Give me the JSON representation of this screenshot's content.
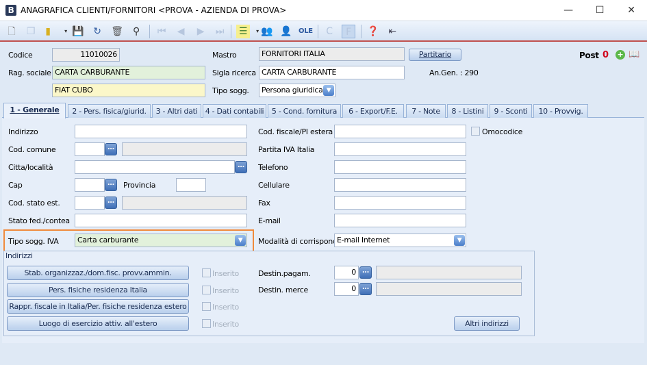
{
  "window": {
    "title": "ANAGRAFICA CLIENTI/FORNITORI <PROVA - AZIENDA DI PROVA>",
    "app_icon": "B",
    "minimize": "—",
    "maximize": "☐",
    "close": "✕"
  },
  "header": {
    "codice_label": "Codice",
    "codice_value": "11010026",
    "mastro_label": "Mastro",
    "mastro_value": "FORNITORI ITALIA",
    "partitario_label": "Partitario",
    "post_label": "Post",
    "post_value": "0",
    "rag_sociale_label": "Rag. sociale",
    "rag_sociale_value": "CARTA CARBURANTE",
    "rag_sociale2_value": "FIAT  CUBO",
    "sigla_label": "Sigla ricerca",
    "sigla_value": "CARTA CARBURANTE",
    "angen": "An.Gen.  : 290",
    "tipo_sogg_label": "Tipo sogg.",
    "tipo_sogg_value": "Persona giuridica"
  },
  "tabs": [
    "1 - Generale",
    "2 - Pers. fisica/giurid.",
    "3 - Altri dati",
    "4 - Dati contabili",
    "5 - Cond. fornitura",
    "6 - Export/F.E.",
    "7 - Note",
    "8 - Listini",
    "9 - Sconti",
    "10 - Provvig."
  ],
  "general": {
    "indirizzo": "Indirizzo",
    "cod_comune": "Cod. comune",
    "citta": "Citta/località",
    "cap": "Cap",
    "provincia": "Provincia",
    "cod_stato": "Cod. stato est.",
    "stato_fed": "Stato fed./contea",
    "tipo_iva_label": "Tipo sogg. IVA",
    "tipo_iva_value": "Carta carburante",
    "cod_fiscale": "Cod. fiscale/PI estera",
    "omocodice": "Omocodice",
    "partita_iva": "Partita IVA Italia",
    "telefono": "Telefono",
    "cellulare": "Cellulare",
    "fax": "Fax",
    "email": "E-mail",
    "modalita_label": "Modalità di corrispond.",
    "modalita_value": "E-mail Internet"
  },
  "indirizzi": {
    "title": "Indirizzi",
    "buttons": [
      "Stab. organizzaz./dom.fisc. provv.ammin.",
      "Pers. fisiche residenza Italia",
      "Rappr. fiscale in Italia/Per. fisiche residenza estero",
      "Luogo di esercizio attiv. all'estero"
    ],
    "inserito": "Inserito",
    "destin_pagam": "Destin.pagam.",
    "destin_pagam_value": "0",
    "destin_merce": "Destin. merce",
    "destin_merce_value": "0",
    "altri": "Altri indirizzi"
  },
  "colors": {
    "highlight": "#f08a3c",
    "post_value": "#d0021b"
  }
}
